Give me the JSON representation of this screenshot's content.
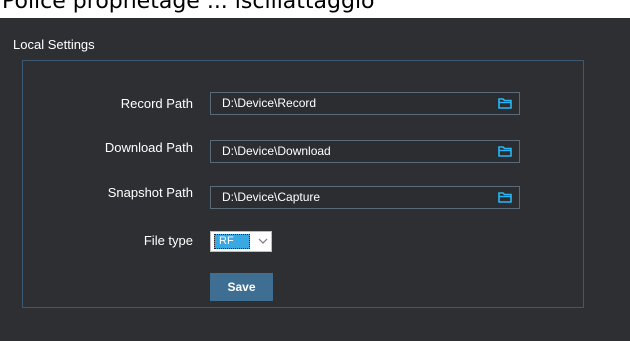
{
  "top_strip_text": "Police prophetage ... iscillattaggio",
  "panel_title": "Local Settings",
  "rows": [
    {
      "label": "Record Path",
      "value": "D:\\Device\\Record"
    },
    {
      "label": "Download Path",
      "value": "D:\\Device\\Download"
    },
    {
      "label": "Snapshot Path",
      "value": "D:\\Device\\Capture"
    }
  ],
  "file_type": {
    "label": "File type",
    "selected": "RF"
  },
  "save_label": "Save",
  "icons": {
    "browse": "folder-icon",
    "dropdown": "chevron-down-icon"
  },
  "colors": {
    "background": "#2d2f33",
    "accent": "#3e6e92",
    "selection": "#39a8e3",
    "icon": "#29b6f6"
  }
}
